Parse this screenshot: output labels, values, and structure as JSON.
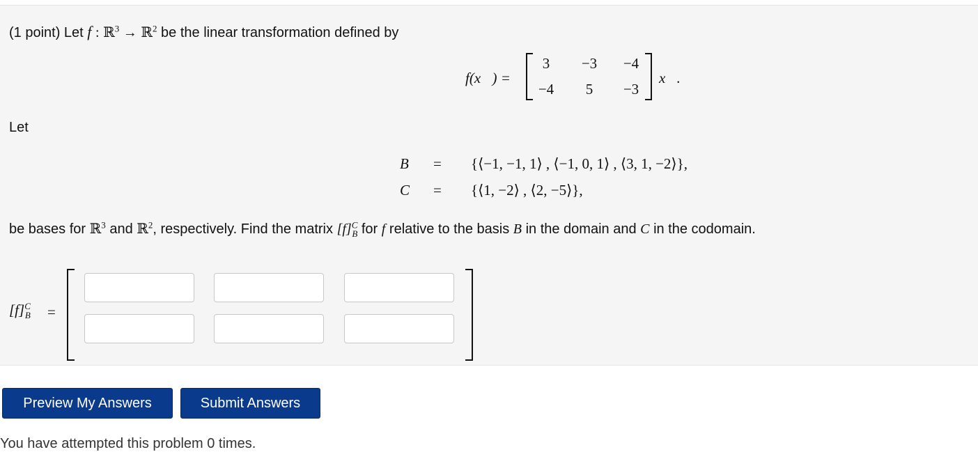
{
  "intro": {
    "prefix": "(1 point) Let",
    "f": "f",
    "colon": ":",
    "domain_space": "ℝ",
    "domain_exp": "3",
    "arrow": "→",
    "codomain_space": "ℝ",
    "codomain_exp": "2",
    "suffix": "be the linear transformation defined by"
  },
  "equation": {
    "lhs": "f(x⃗) =",
    "rhs": "x⃗.",
    "matrix": [
      [
        "3",
        "−3",
        "−4"
      ],
      [
        "−4",
        "5",
        "−3"
      ]
    ]
  },
  "let_label": "Let",
  "bases": [
    {
      "name": "B",
      "eq": "=",
      "value": "{⟨−1, −1, 1⟩ , ⟨−1, 0, 1⟩ , ⟨3, 1, −2⟩},"
    },
    {
      "name": "C",
      "eq": "=",
      "value": "{⟨1, −2⟩ , ⟨2, −5⟩},"
    }
  ],
  "question": {
    "p1": "be bases for",
    "r3": "ℝ",
    "r3_exp": "3",
    "and": "and",
    "r2": "ℝ",
    "r2_exp": "2",
    "p2": ", respectively. Find the matrix",
    "mat": "[f]",
    "mat_sup": "C",
    "mat_sub": "B",
    "p3": "for",
    "f": "f",
    "p4": "relative to the basis",
    "B": "B",
    "p5": "in the domain and",
    "C": "C",
    "p6": "in the codomain."
  },
  "answer": {
    "label": "[f]",
    "label_sup": "C",
    "label_sub": "B",
    "eq": "=",
    "inputs": [
      [
        "",
        "",
        ""
      ],
      [
        "",
        "",
        ""
      ]
    ]
  },
  "buttons": {
    "preview": "Preview My Answers",
    "submit": "Submit Answers"
  },
  "footer": "You have attempted this problem 0 times."
}
